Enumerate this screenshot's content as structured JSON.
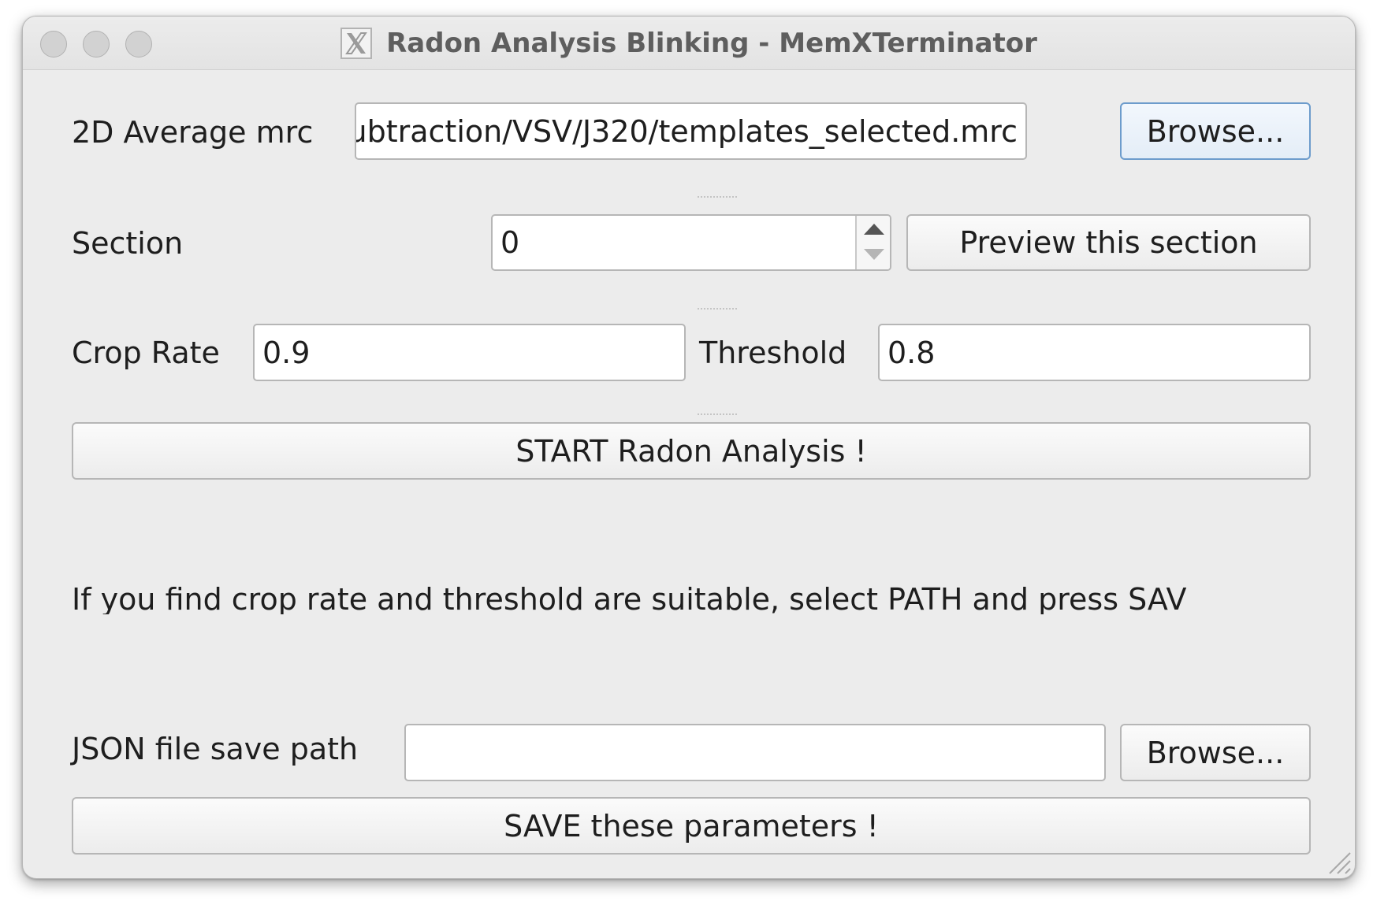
{
  "window": {
    "title": "Radon Analysis Blinking - MemXTerminator",
    "app_icon": "x11-icon"
  },
  "mrc": {
    "label": "2D Average mrc",
    "value": "ubtraction/VSV/J320/templates_selected.mrc",
    "browse_label": "Browse..."
  },
  "section": {
    "label": "Section",
    "value": "0",
    "preview_label": "Preview this section"
  },
  "params": {
    "crop_label": "Crop Rate",
    "crop_value": "0.9",
    "threshold_label": "Threshold",
    "threshold_value": "0.8"
  },
  "start_label": "START Radon Analysis !",
  "info_text": "If you find crop rate and threshold are suitable, select PATH and press SAV",
  "json_path": {
    "label": "JSON file save path",
    "value": "",
    "browse_label": "Browse..."
  },
  "save_label": "SAVE these parameters !",
  "colors": {
    "window_bg": "#ececec",
    "focus_border": "#6d9ccc"
  }
}
